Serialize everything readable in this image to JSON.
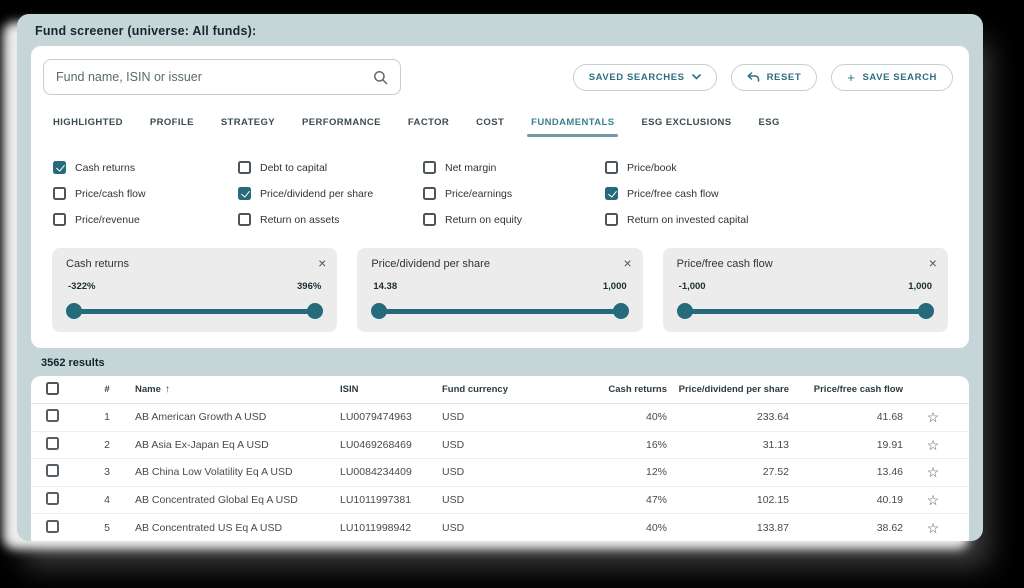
{
  "window": {
    "title": "Fund screener (universe: All funds):"
  },
  "search": {
    "placeholder": "Fund name, ISIN or issuer"
  },
  "actions": {
    "saved_searches": "SAVED SEARCHES",
    "reset": "RESET",
    "save_search": "SAVE SEARCH",
    "save_search_plus": "+"
  },
  "tabs": [
    {
      "label": "HIGHLIGHTED",
      "active": false
    },
    {
      "label": "PROFILE",
      "active": false
    },
    {
      "label": "STRATEGY",
      "active": false
    },
    {
      "label": "PERFORMANCE",
      "active": false
    },
    {
      "label": "FACTOR",
      "active": false
    },
    {
      "label": "COST",
      "active": false
    },
    {
      "label": "FUNDAMENTALS",
      "active": true
    },
    {
      "label": "ESG EXCLUSIONS",
      "active": false
    },
    {
      "label": "ESG",
      "active": false
    }
  ],
  "filters": {
    "checkboxes": [
      {
        "label": "Cash returns",
        "checked": true
      },
      {
        "label": "Debt to capital",
        "checked": false
      },
      {
        "label": "Net margin",
        "checked": false
      },
      {
        "label": "Price/book",
        "checked": false
      },
      {
        "label": "Price/cash flow",
        "checked": false
      },
      {
        "label": "Price/dividend per share",
        "checked": true
      },
      {
        "label": "Price/earnings",
        "checked": false
      },
      {
        "label": "Price/free cash flow",
        "checked": true
      },
      {
        "label": "Price/revenue",
        "checked": false
      },
      {
        "label": "Return on assets",
        "checked": false
      },
      {
        "label": "Return on equity",
        "checked": false
      },
      {
        "label": "Return on invested capital",
        "checked": false
      }
    ]
  },
  "slider_cards": [
    {
      "title": "Cash returns",
      "min_label": "-322%",
      "max_label": "396%",
      "close": "×"
    },
    {
      "title": "Price/dividend per share",
      "min_label": "14.38",
      "max_label": "1,000",
      "close": "×"
    },
    {
      "title": "Price/free cash flow",
      "min_label": "-1,000",
      "max_label": "1,000",
      "close": "×"
    }
  ],
  "results": {
    "count_label": "3562 results"
  },
  "table": {
    "headers": {
      "number": "#",
      "name": "Name",
      "sort_arrow": "↑",
      "isin": "ISIN",
      "currency": "Fund currency",
      "cash_returns": "Cash returns",
      "price_dividend_per_share": "Price/dividend per share",
      "price_free_cash_flow": "Price/free cash flow"
    },
    "star_glyph": "☆",
    "rows": [
      {
        "num": "1",
        "name": "AB American Growth A USD",
        "isin": "LU0079474963",
        "currency": "USD",
        "cash_returns": "40%",
        "price_dividend_per_share": "233.64",
        "price_free_cash_flow": "41.68"
      },
      {
        "num": "2",
        "name": "AB Asia Ex-Japan Eq A USD",
        "isin": "LU0469268469",
        "currency": "USD",
        "cash_returns": "16%",
        "price_dividend_per_share": "31.13",
        "price_free_cash_flow": "19.91"
      },
      {
        "num": "3",
        "name": "AB China Low Volatility Eq A USD",
        "isin": "LU0084234409",
        "currency": "USD",
        "cash_returns": "12%",
        "price_dividend_per_share": "27.52",
        "price_free_cash_flow": "13.46"
      },
      {
        "num": "4",
        "name": "AB Concentrated Global Eq A USD",
        "isin": "LU1011997381",
        "currency": "USD",
        "cash_returns": "47%",
        "price_dividend_per_share": "102.15",
        "price_free_cash_flow": "40.19"
      },
      {
        "num": "5",
        "name": "AB Concentrated US Eq A USD",
        "isin": "LU1011998942",
        "currency": "USD",
        "cash_returns": "40%",
        "price_dividend_per_share": "133.87",
        "price_free_cash_flow": "38.62"
      }
    ]
  },
  "colors": {
    "accent_teal": "#256b7c",
    "window_bg": "#c6d6d8",
    "filter_card_grey": "#ececec"
  }
}
